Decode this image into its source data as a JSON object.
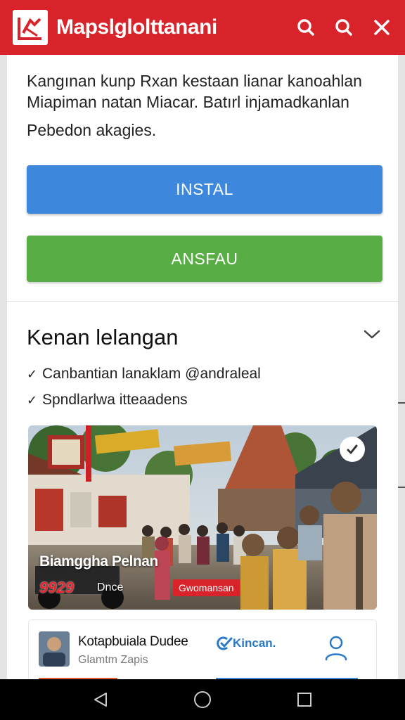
{
  "app": {
    "title": "Mapslglolttanani",
    "brand_color": "#d8232a",
    "logo_icon": "logo-icon",
    "toolbar_icons": [
      "search-icon",
      "search-icon",
      "close-icon"
    ]
  },
  "intro": {
    "line1": "Kangınan kunp Rxan kestaan lianar kanoahlan",
    "line2": "Miapiman natan Miacar. Batırl injamadkanlan",
    "line3": "Pebedon akagies."
  },
  "buttons": {
    "install": {
      "label": "INSTAL",
      "color": "#3d87dd"
    },
    "secondary": {
      "label": "ANSFAU",
      "color": "#58ad45"
    }
  },
  "section": {
    "title": "Kenan lelangan",
    "features": [
      "Canbantian lanaklam @andraleal",
      "Spndlarlwa itteaadens"
    ]
  },
  "photo": {
    "title": "Biamggha Pelnan",
    "price": "9929",
    "price_unit": "Dnce",
    "tag": "Gwomansan"
  },
  "card": {
    "name": "Kotapbuiala Dudee",
    "subtitle": "Glamtm Zapis",
    "link_label": "Kincan.",
    "user_icon": "user-icon"
  },
  "navbar": {
    "icons": [
      "back-icon",
      "home-icon",
      "recents-icon"
    ]
  }
}
